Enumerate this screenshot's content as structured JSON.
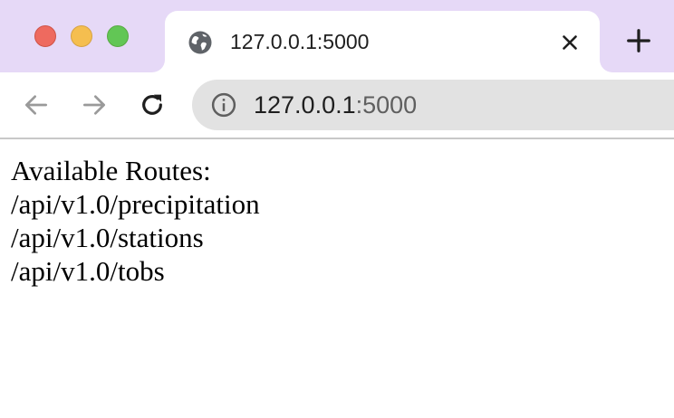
{
  "tab": {
    "title": "127.0.0.1:5000"
  },
  "toolbar": {
    "url_host": "127.0.0.1",
    "url_port": ":5000"
  },
  "page": {
    "heading": "Available Routes:",
    "routes": [
      "/api/v1.0/precipitation",
      "/api/v1.0/stations",
      "/api/v1.0/tobs"
    ]
  },
  "colors": {
    "tabstrip": "#e6d9f7",
    "omnibox": "#e2e2e2",
    "traffic_close": "#ee6a5f",
    "traffic_minimize": "#f5be4f",
    "traffic_maximize": "#62c655"
  },
  "icons": {
    "tab_favicon": "globe-icon",
    "tab_close": "close-icon",
    "new_tab": "plus-icon",
    "back": "arrow-left-icon",
    "forward": "arrow-right-icon",
    "reload": "reload-icon",
    "site_info": "info-icon"
  }
}
